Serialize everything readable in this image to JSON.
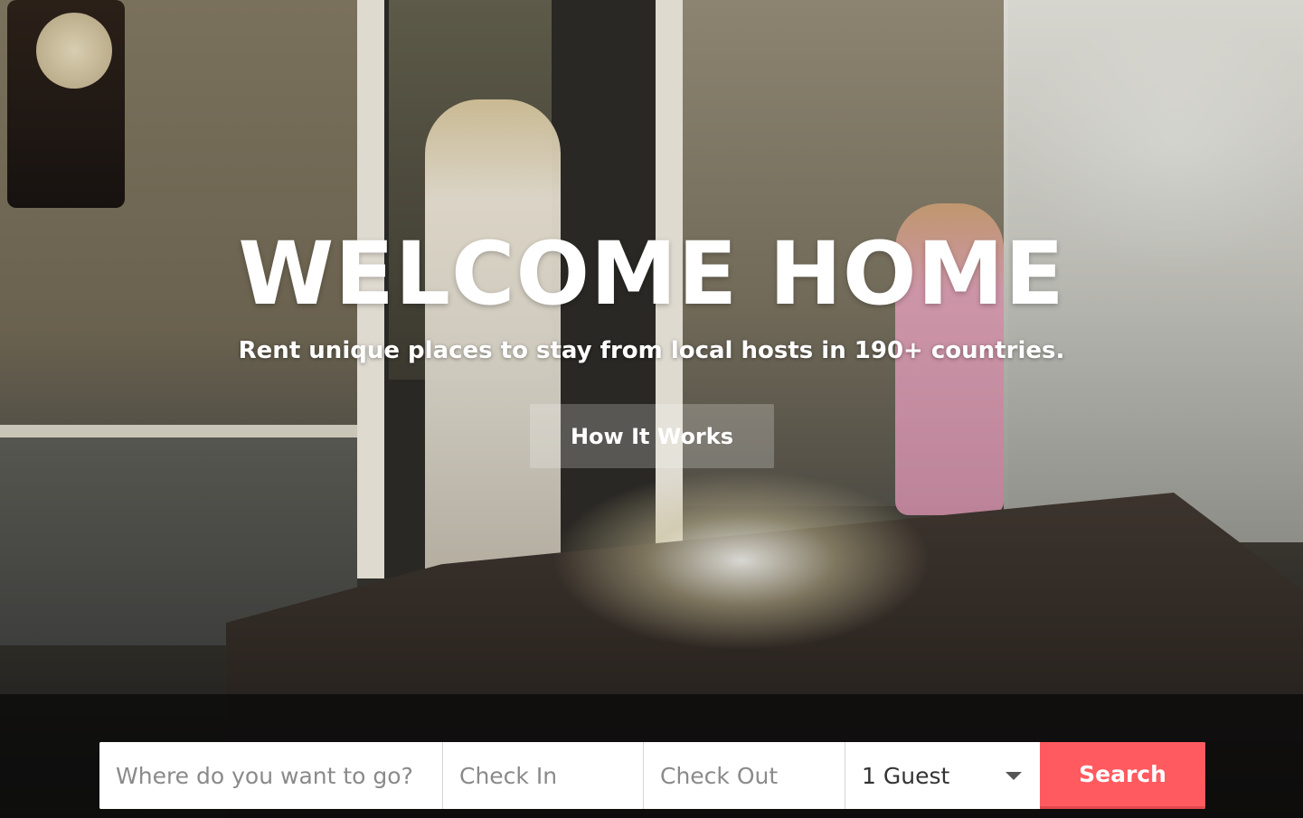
{
  "hero": {
    "headline": "WELCOME HOME",
    "subheadline": "Rent unique places to stay from local hosts in 190+ countries.",
    "cta_label": "How It Works"
  },
  "search": {
    "where_placeholder": "Where do you want to go?",
    "checkin_placeholder": "Check In",
    "checkout_placeholder": "Check Out",
    "guests_value": "1 Guest",
    "search_label": "Search"
  },
  "colors": {
    "accent": "#ff5a5f",
    "overlay": "#0a0a0a"
  },
  "icons": {
    "guests_dropdown": "caret-down-icon"
  }
}
